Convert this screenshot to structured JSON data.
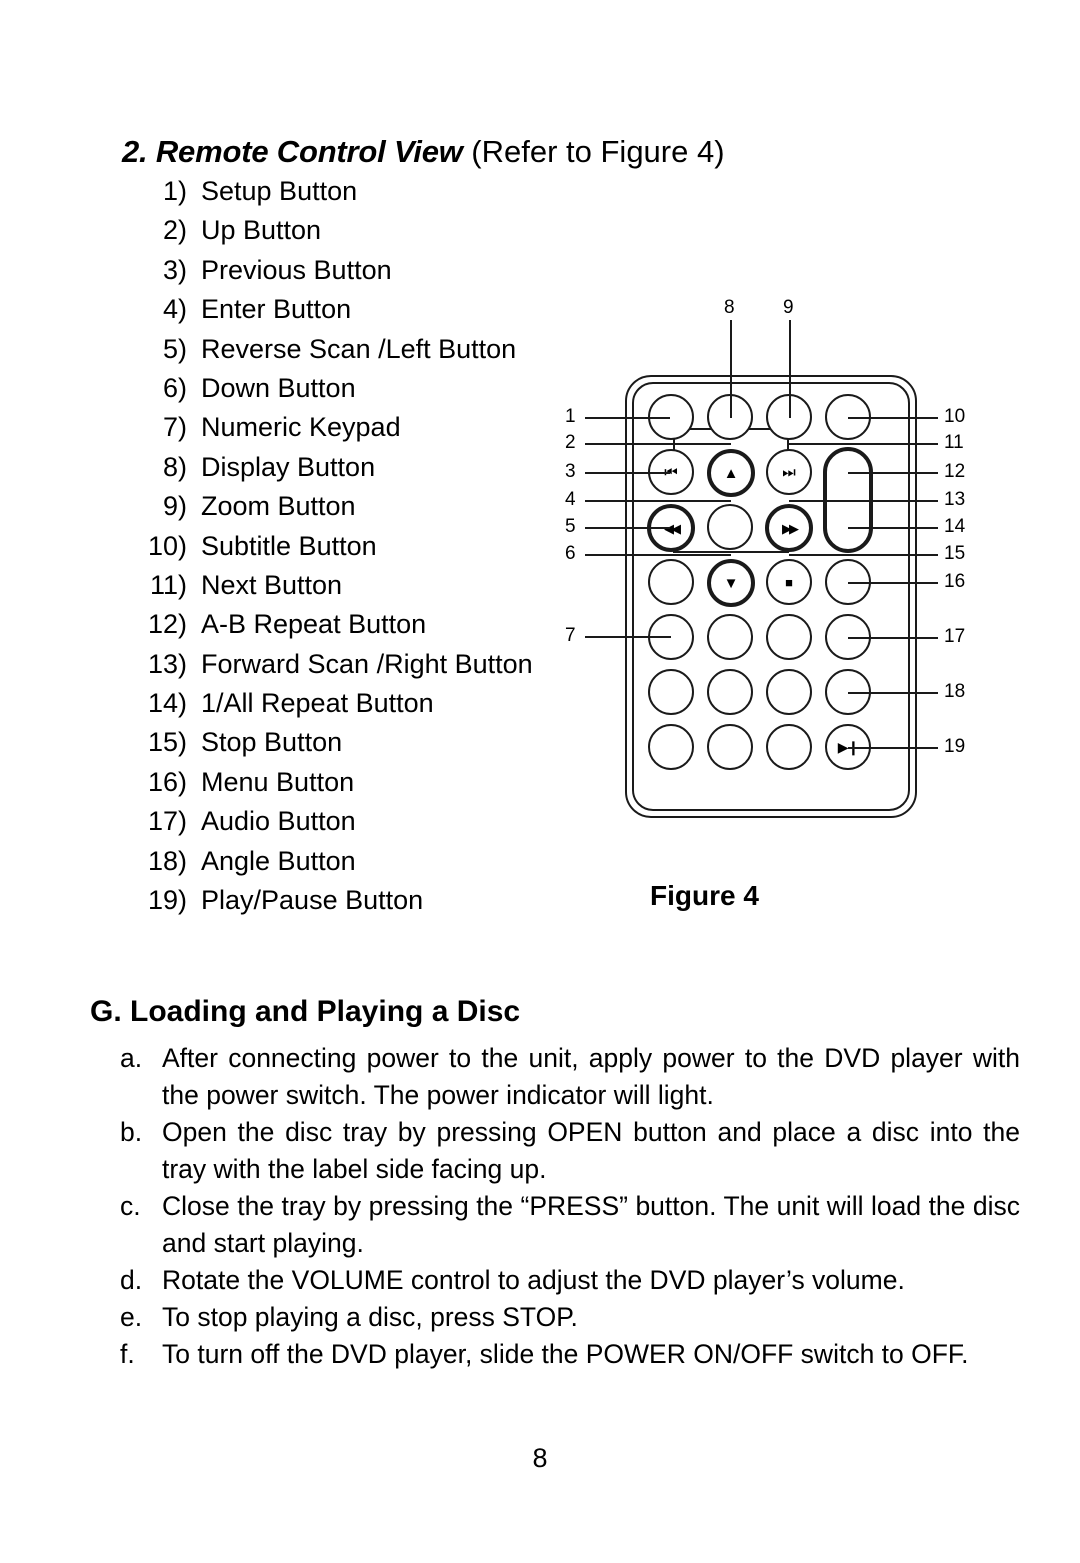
{
  "document": {
    "page_number": "8"
  },
  "section_remote": {
    "heading_bold_italic": "2. Remote Control View",
    "heading_plain": " (Refer to Figure 4)",
    "items": [
      {
        "num": "1)",
        "label": "Setup Button"
      },
      {
        "num": "2)",
        "label": "Up Button"
      },
      {
        "num": "3)",
        "label": "Previous Button"
      },
      {
        "num": "4)",
        "label": "Enter Button"
      },
      {
        "num": "5)",
        "label": "Reverse Scan /Left Button"
      },
      {
        "num": "6)",
        "label": "Down Button"
      },
      {
        "num": "7)",
        "label": "Numeric Keypad"
      },
      {
        "num": "8)",
        "label": "Display Button"
      },
      {
        "num": "9)",
        "label": "Zoom Button"
      },
      {
        "num": "10)",
        "label": "Subtitle Button"
      },
      {
        "num": "11)",
        "label": "Next Button"
      },
      {
        "num": "12)",
        "label": "A-B Repeat Button"
      },
      {
        "num": "13)",
        "label": "Forward Scan /Right Button"
      },
      {
        "num": "14)",
        "label": "1/All Repeat Button"
      },
      {
        "num": "15)",
        "label": "Stop Button"
      },
      {
        "num": "16)",
        "label": "Menu Button"
      },
      {
        "num": "17)",
        "label": "Audio Button"
      },
      {
        "num": "18)",
        "label": "Angle Button"
      },
      {
        "num": "19)",
        "label": "Play/Pause Button"
      }
    ]
  },
  "figure": {
    "caption": "Figure 4",
    "callouts": {
      "c1": "1",
      "c2": "2",
      "c3": "3",
      "c4": "4",
      "c5": "5",
      "c6": "6",
      "c7": "7",
      "c8": "8",
      "c9": "9",
      "c10": "10",
      "c11": "11",
      "c12": "12",
      "c13": "13",
      "c14": "14",
      "c15": "15",
      "c16": "16",
      "c17": "17",
      "c18": "18",
      "c19": "19"
    },
    "button_glyphs": {
      "previous": "⏮",
      "next": "⏭",
      "reverse_scan": "◀◀",
      "forward_scan": "▶▶",
      "up": "▲",
      "down": "▼",
      "stop": "■",
      "play_pause": "▶❙"
    }
  },
  "section_loading": {
    "heading": "G. Loading and Playing a Disc",
    "steps": [
      {
        "marker": "a.",
        "text": "After connecting power to the unit, apply power to the DVD player with the power switch. The power indicator will light."
      },
      {
        "marker": "b.",
        "text": "Open the disc tray by pressing OPEN button and place a disc into the tray with the label side facing up."
      },
      {
        "marker": "c.",
        "text": "Close the tray by pressing the “PRESS” button. The unit will load the disc and start playing."
      },
      {
        "marker": "d.",
        "text": "Rotate the VOLUME control to adjust the DVD player’s volume."
      },
      {
        "marker": "e.",
        "text": "To stop playing a disc, press STOP."
      },
      {
        "marker": "f.",
        "text": "To turn off the DVD player, slide the POWER ON/OFF switch to OFF."
      }
    ]
  }
}
